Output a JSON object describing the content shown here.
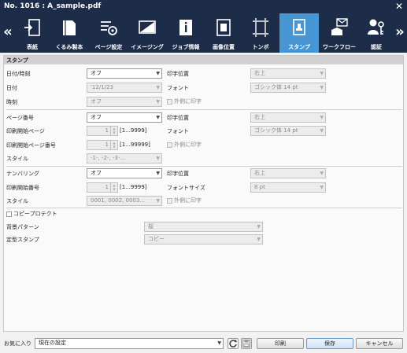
{
  "window": {
    "title": "No. 1016 : A_sample.pdf"
  },
  "toolbar": {
    "tabs": [
      {
        "label": "表紙",
        "icon": "cover-icon"
      },
      {
        "label": "くるみ製本",
        "icon": "binding-icon"
      },
      {
        "label": "ページ設定",
        "icon": "page-settings-icon"
      },
      {
        "label": "イメージング",
        "icon": "imaging-icon"
      },
      {
        "label": "ジョブ情報",
        "icon": "job-info-icon"
      },
      {
        "label": "画像位置",
        "icon": "image-position-icon"
      },
      {
        "label": "トンボ",
        "icon": "crop-marks-icon"
      },
      {
        "label": "スタンプ",
        "icon": "stamp-icon",
        "active": true
      },
      {
        "label": "ワークフロー",
        "icon": "workflow-icon"
      },
      {
        "label": "認証",
        "icon": "authentication-icon"
      }
    ],
    "active_color": "#4796d3"
  },
  "panel": {
    "header": "スタンプ",
    "datetime": {
      "label": "日付/時刻",
      "value": "オフ",
      "date_label": "日付",
      "date_value": "'12/1/23",
      "time_label": "時刻",
      "time_value": "オフ",
      "pos_label": "印字位置",
      "pos_value": "右上",
      "font_label": "フォント",
      "font_value": "ゴシック体 14 pt",
      "outside_label": "外側に印字"
    },
    "page_number": {
      "label": "ページ番号",
      "value": "オフ",
      "start_page_label": "印刷開始ページ",
      "start_page_value": "1",
      "start_page_range": "[1...9999]",
      "start_num_label": "印刷開始ページ番号",
      "start_num_value": "1",
      "start_num_range": "[1...99999]",
      "style_label": "スタイル",
      "style_value": "-1-, -2-, -3-...",
      "pos_label": "印字位置",
      "pos_value": "右上",
      "font_label": "フォント",
      "font_value": "ゴシック体 14 pt",
      "outside_label": "外側に印字"
    },
    "numbering": {
      "label": "ナンバリング",
      "value": "オフ",
      "start_label": "印刷開始番号",
      "start_value": "1",
      "start_range": "[1...9999]",
      "style_label": "スタイル",
      "style_value": "0001, 0002, 0003...",
      "pos_label": "印字位置",
      "pos_value": "右上",
      "size_label": "フォントサイズ",
      "size_value": "8 pt",
      "outside_label": "外側に印字"
    },
    "copy_protect": {
      "label": "コピープロテクト",
      "pattern_label": "背景パターン",
      "pattern_value": "桜",
      "stamp_label": "定型スタンプ",
      "stamp_value": "コピー"
    }
  },
  "footer": {
    "favorites_label": "お気に入り",
    "favorites_value": "現在の設定",
    "print_label": "印刷",
    "save_label": "保存",
    "cancel_label": "キャンセル"
  }
}
